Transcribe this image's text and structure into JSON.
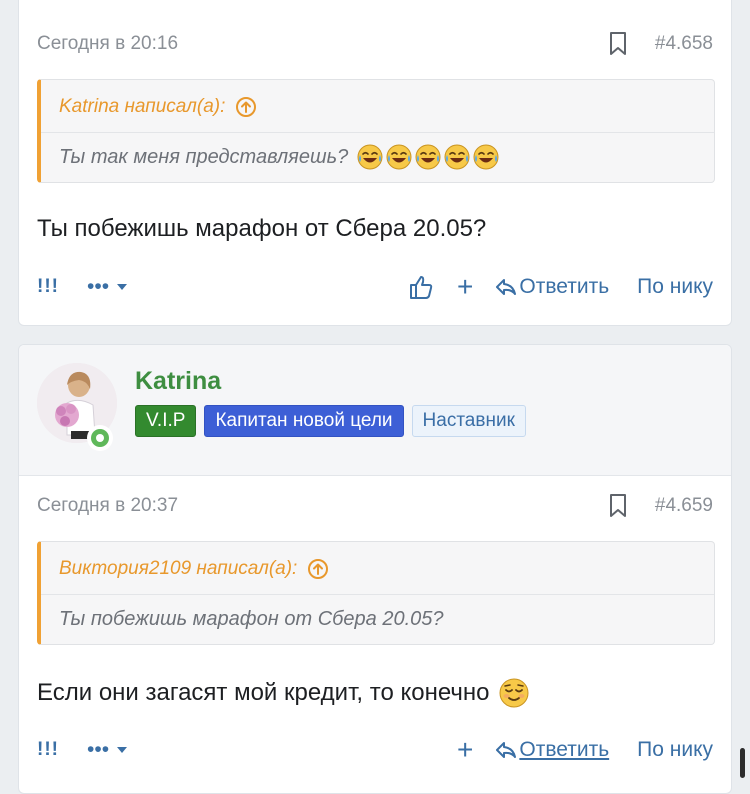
{
  "posts": [
    {
      "date": "Сегодня в 20:16",
      "number": "#4.658",
      "quote": {
        "author_line": "Katrina написал(а):",
        "text": "Ты так меня представляешь?",
        "emojis": [
          "joy-emoji",
          "joy-emoji",
          "joy-emoji",
          "joy-emoji",
          "joy-emoji"
        ]
      },
      "message": "Ты побежишь марафон от Сбера 20.05?",
      "actions": {
        "report": "!!!",
        "more": "•••",
        "reply": "Ответить",
        "by_nick": "По нику"
      }
    },
    {
      "user": {
        "name": "Katrina",
        "badges": [
          "V.I.P",
          "Капитан новой цели",
          "Наставник"
        ]
      },
      "date": "Сегодня в 20:37",
      "number": "#4.659",
      "quote": {
        "author_line": "Виктория2109 написал(а):",
        "text": "Ты побежишь марафон от Сбера 20.05?"
      },
      "message": "Если они загасят мой кредит, то конечно",
      "message_emoji": "relieved-emoji",
      "actions": {
        "report": "!!!",
        "more": "•••",
        "reply": "Ответить",
        "by_nick": "По нику"
      }
    }
  ],
  "colors": {
    "link": "#3a6fa5",
    "quote_accent": "#f0a134",
    "username": "#3e8e41",
    "vip_badge": "#338a2f",
    "captain_badge": "#3d5fd6"
  }
}
